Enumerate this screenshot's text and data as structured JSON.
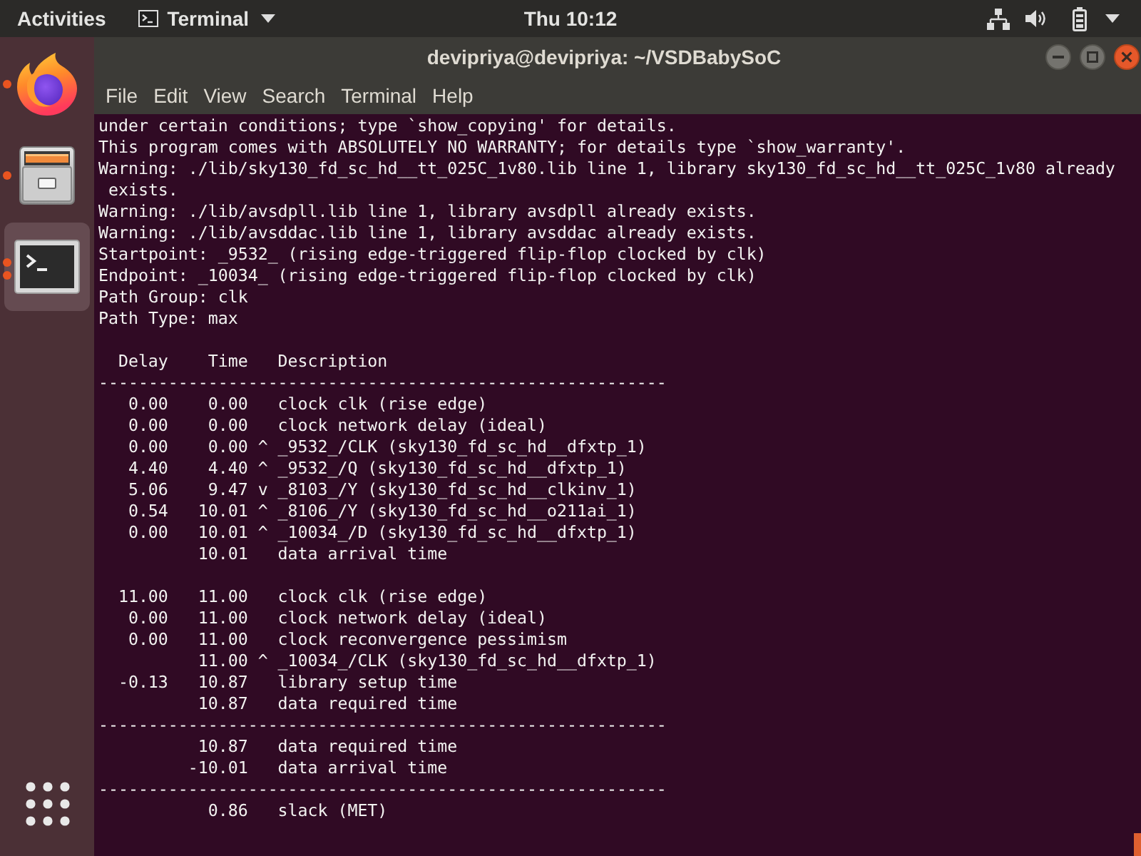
{
  "top_bar": {
    "activities": "Activities",
    "app_menu": "Terminal",
    "clock": "Thu 10:12"
  },
  "dock": {
    "items": [
      {
        "kind": "browser",
        "running": true,
        "multiple_windows": false,
        "selected": false
      },
      {
        "kind": "files",
        "running": true,
        "multiple_windows": false,
        "selected": false
      },
      {
        "kind": "terminal",
        "running": true,
        "multiple_windows": true,
        "selected": true
      }
    ]
  },
  "window": {
    "title": "devipriya@devipriya: ~/VSDBabySoC",
    "menu": [
      "File",
      "Edit",
      "View",
      "Search",
      "Terminal",
      "Help"
    ],
    "output_lines": [
      "under certain conditions; type `show_copying' for details.",
      "This program comes with ABSOLUTELY NO WARRANTY; for details type `show_warranty'.",
      "Warning: ./lib/sky130_fd_sc_hd__tt_025C_1v80.lib line 1, library sky130_fd_sc_hd__tt_025C_1v80 already",
      " exists.",
      "Warning: ./lib/avsdpll.lib line 1, library avsdpll already exists.",
      "Warning: ./lib/avsddac.lib line 1, library avsddac already exists.",
      "Startpoint: _9532_ (rising edge-triggered flip-flop clocked by clk)",
      "Endpoint: _10034_ (rising edge-triggered flip-flop clocked by clk)",
      "Path Group: clk",
      "Path Type: max"
    ],
    "timing_report": {
      "columns": [
        "Delay",
        "Time",
        "Description"
      ],
      "groups": [
        {
          "divider": "---------------------------------------------------------",
          "rows": [
            {
              "delay": "0.00",
              "time": "0.00",
              "description": "clock clk (rise edge)"
            },
            {
              "delay": "0.00",
              "time": "0.00",
              "description": "clock network delay (ideal)"
            },
            {
              "delay": "0.00",
              "time": "0.00",
              "edge": "^",
              "description": "_9532_/CLK (sky130_fd_sc_hd__dfxtp_1)"
            },
            {
              "delay": "4.40",
              "time": "4.40",
              "edge": "^",
              "description": "_9532_/Q (sky130_fd_sc_hd__dfxtp_1)"
            },
            {
              "delay": "5.06",
              "time": "9.47",
              "edge": "v",
              "description": "_8103_/Y (sky130_fd_sc_hd__clkinv_1)"
            },
            {
              "delay": "0.54",
              "time": "10.01",
              "edge": "^",
              "description": "_8106_/Y (sky130_fd_sc_hd__o211ai_1)"
            },
            {
              "delay": "0.00",
              "time": "10.01",
              "edge": "^",
              "description": "_10034_/D (sky130_fd_sc_hd__dfxtp_1)"
            },
            {
              "time": "10.01",
              "description": "data arrival time"
            }
          ]
        },
        {
          "rows": [
            {
              "delay": "11.00",
              "time": "11.00",
              "description": "clock clk (rise edge)"
            },
            {
              "delay": "0.00",
              "time": "11.00",
              "description": "clock network delay (ideal)"
            },
            {
              "delay": "0.00",
              "time": "11.00",
              "description": "clock reconvergence pessimism"
            },
            {
              "time": "11.00",
              "edge": "^",
              "description": "_10034_/CLK (sky130_fd_sc_hd__dfxtp_1)"
            },
            {
              "delay": "-0.13",
              "time": "10.87",
              "description": "library setup time"
            },
            {
              "time": "10.87",
              "description": "data required time"
            }
          ]
        },
        {
          "divider": "---------------------------------------------------------",
          "rows": [
            {
              "time": "10.87",
              "description": "data required time"
            },
            {
              "time": "-10.01",
              "description": "data arrival time"
            }
          ]
        },
        {
          "divider": "---------------------------------------------------------",
          "rows": [
            {
              "time": "0.86",
              "description": "slack (MET)"
            }
          ]
        }
      ]
    }
  }
}
